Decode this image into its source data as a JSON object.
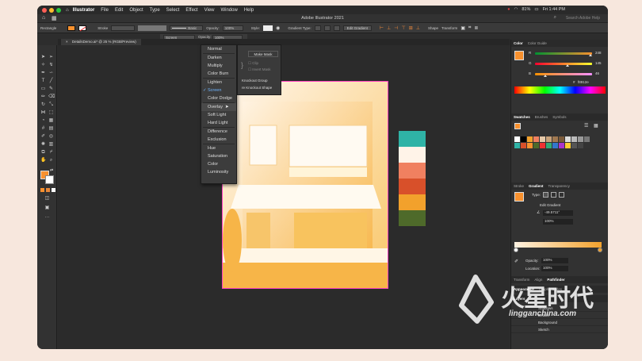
{
  "menubar": {
    "app": "Illustrator",
    "menus": [
      "File",
      "Edit",
      "Object",
      "Type",
      "Select",
      "Effect",
      "View",
      "Window",
      "Help"
    ],
    "battery": "81%",
    "clock": "Fri 1:44 PM"
  },
  "titlebar": {
    "title": "Adobe Illustrator 2021",
    "search_placeholder": "Search Adobe Help"
  },
  "control": {
    "selection_type": "Rectangle",
    "stroke_label": "Stroke",
    "stroke_profile": "Basic",
    "opacity_label": "Opacity:",
    "opacity_value": "100%",
    "style_label": "Style:",
    "gradient_type_label": "Gradient Type:",
    "edit_gradient": "Edit Gradient",
    "shape_label": "Shape",
    "transform_label": "Transform",
    "blend_mode": "Screen",
    "opacity_small_label": "Opacity:",
    "opacity_small_value": "100%"
  },
  "document_tab": {
    "label": "DetailsDemo.ai* @ 25 % (RGB/Preview)"
  },
  "blend_menu": {
    "items": [
      "Normal",
      "Darken",
      "Multiply",
      "Color Burn",
      "Lighten",
      "Screen",
      "Color Dodge",
      "Overlay",
      "Soft Light",
      "Hard Light",
      "Difference",
      "Exclusion",
      "Hue",
      "Saturation",
      "Color",
      "Luminosity"
    ],
    "selected": "Screen",
    "hovered": "Overlay"
  },
  "transparency_popup": {
    "make_mask": "Make Mask",
    "clip": "Clip",
    "invert_mask": "Invert Mask",
    "knockout_group": "Knockout Group",
    "knockout_shape": "re Knockout Shape"
  },
  "palette": {
    "colors": [
      "#2fb3a6",
      "#fff3e8",
      "#f08060",
      "#d8502a",
      "#f2a12c",
      "#4e6a2a"
    ]
  },
  "color_panel": {
    "tabs": [
      "Color",
      "Color Guide"
    ],
    "r_label": "R",
    "g_label": "G",
    "b_label": "B",
    "r": "248",
    "g": "145",
    "b": "46",
    "r_fraction": 0.97,
    "g_fraction": 0.57,
    "b_fraction": 0.18,
    "hex": "f8912e",
    "fill": "#f8912e"
  },
  "swatches": {
    "tabs": [
      "Swatches",
      "Brushes",
      "Symbols"
    ]
  },
  "gradient_panel": {
    "tabs": [
      "Stroke",
      "Gradient",
      "Transparency"
    ],
    "type_label": "Type:",
    "edit_gradient": "Edit Gradient",
    "angle": "-49.5711°",
    "ratio": "100%",
    "opacity_label": "Opacity:",
    "opacity_value": "100%",
    "location_label": "Location:",
    "location_value": "100%"
  },
  "lower_tabs": [
    "Transform",
    "Align",
    "Pathfinder"
  ],
  "appearance_tabs": [
    "Appearance",
    "Graphic Styles"
  ],
  "layers": {
    "tab": "Layers",
    "rows": [
      "Shadows",
      "Details",
      "Background",
      "Sketch"
    ]
  },
  "watermark": {
    "logo": "火星时代",
    "url": "lingganchina.com"
  }
}
